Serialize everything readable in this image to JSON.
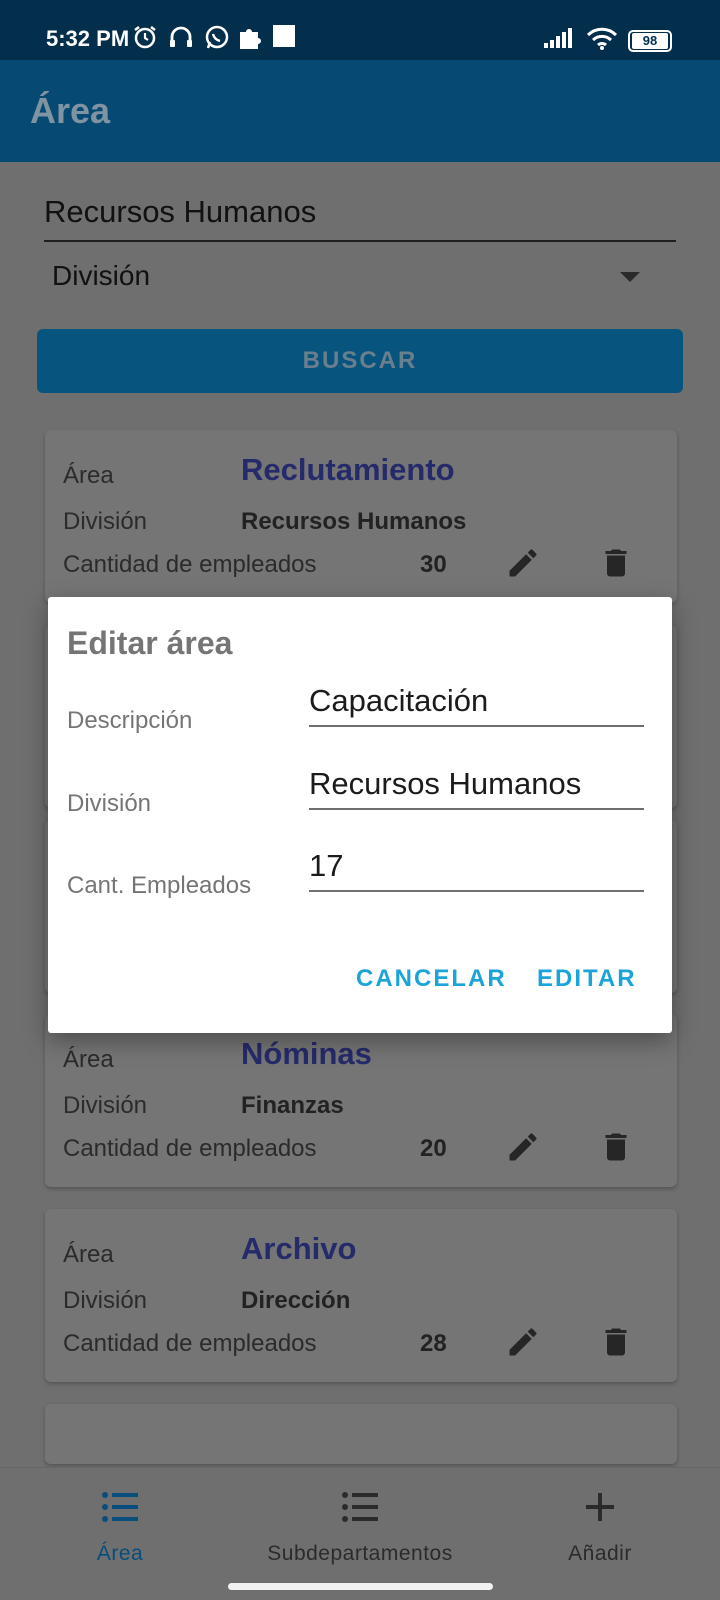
{
  "status_bar": {
    "time": "5:32 PM",
    "battery": "98"
  },
  "app_bar": {
    "title": "Área"
  },
  "search": {
    "value": "Recursos Humanos",
    "division_placeholder": "División",
    "button_label": "BUSCAR"
  },
  "labels": {
    "area": "Área",
    "division": "División",
    "employees": "Cantidad de empleados"
  },
  "cards": [
    {
      "area": "Reclutamiento",
      "division": "Recursos Humanos",
      "count": "30"
    },
    {
      "area": "Nóminas",
      "division": "Finanzas",
      "count": "20"
    },
    {
      "area": "Archivo",
      "division": "Dirección",
      "count": "28"
    }
  ],
  "dialog": {
    "title": "Editar área",
    "fields": [
      {
        "label": "Descripción",
        "value": "Capacitación"
      },
      {
        "label": "División",
        "value": "Recursos Humanos"
      },
      {
        "label": "Cant. Empleados",
        "value": "17"
      }
    ],
    "cancel_label": "CANCELAR",
    "edit_label": "EDITAR"
  },
  "bottom_nav": [
    {
      "label": "Área",
      "icon": "list-icon"
    },
    {
      "label": "Subdepartamentos",
      "icon": "list-icon"
    },
    {
      "label": "Añadir",
      "icon": "plus-icon"
    }
  ],
  "colors": {
    "accent": "#1ba4d9",
    "app_bar": "#064a73",
    "area_name": "#252a6a"
  }
}
